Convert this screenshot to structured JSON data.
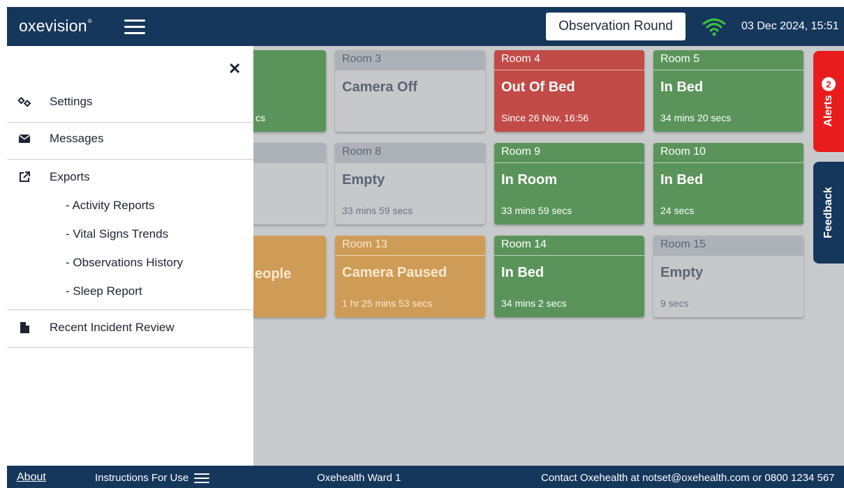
{
  "app": {
    "logo": "oxevision",
    "logo_mark": "®",
    "observation_round": "Observation Round",
    "datetime": "03 Dec 2024, 15:51"
  },
  "colors": {
    "navy": "#16375c",
    "green": "#5a945a",
    "red": "#c24a47",
    "orange": "#cf9c58",
    "grey": "#c6c8cb",
    "alert_red": "#e81c1c"
  },
  "tiles": {
    "col1_row1": {
      "duration": "cs"
    },
    "col1_row3": {
      "state": "eople"
    },
    "room3": {
      "room": "Room 3",
      "state": "Camera Off",
      "duration": ""
    },
    "room4": {
      "room": "Room 4",
      "state": "Out Of Bed",
      "duration": "Since 26 Nov, 16:56"
    },
    "room5": {
      "room": "Room 5",
      "state": "In Bed",
      "duration": "34 mins 20 secs"
    },
    "room8": {
      "room": "Room 8",
      "state": "Empty",
      "duration": "33 mins 59 secs"
    },
    "room9": {
      "room": "Room 9",
      "state": "In Room",
      "duration": "33 mins 59 secs"
    },
    "room10": {
      "room": "Room 10",
      "state": "In Bed",
      "duration": "24 secs"
    },
    "room13": {
      "room": "Room 13",
      "state": "Camera Paused",
      "duration": "1 hr 25 mins 53 secs"
    },
    "room14": {
      "room": "Room 14",
      "state": "In Bed",
      "duration": "34 mins 2 secs"
    },
    "room15": {
      "room": "Room 15",
      "state": "Empty",
      "duration": "9 secs"
    }
  },
  "side_tabs": {
    "alerts_label": "Alerts",
    "alerts_count": "2",
    "feedback_label": "Feedback"
  },
  "drawer": {
    "close_glyph": "✕",
    "settings": "Settings",
    "messages": "Messages",
    "exports": "Exports",
    "exports_sub": [
      "- Activity Reports",
      "- Vital Signs Trends",
      "- Observations History",
      "- Sleep Report"
    ],
    "recent_incident_review": "Recent Incident Review"
  },
  "footer": {
    "about": "About",
    "instructions": "Instructions For Use",
    "ward": "Oxehealth Ward 1",
    "contact": "Contact Oxehealth at notset@oxehealth.com or 0800 1234 567"
  },
  "icons": {
    "menu": "hamburger-icon",
    "wifi": "wifi-icon",
    "settings": "gears-icon",
    "messages": "envelope-icon",
    "exports": "external-link-icon",
    "incident": "document-icon"
  }
}
